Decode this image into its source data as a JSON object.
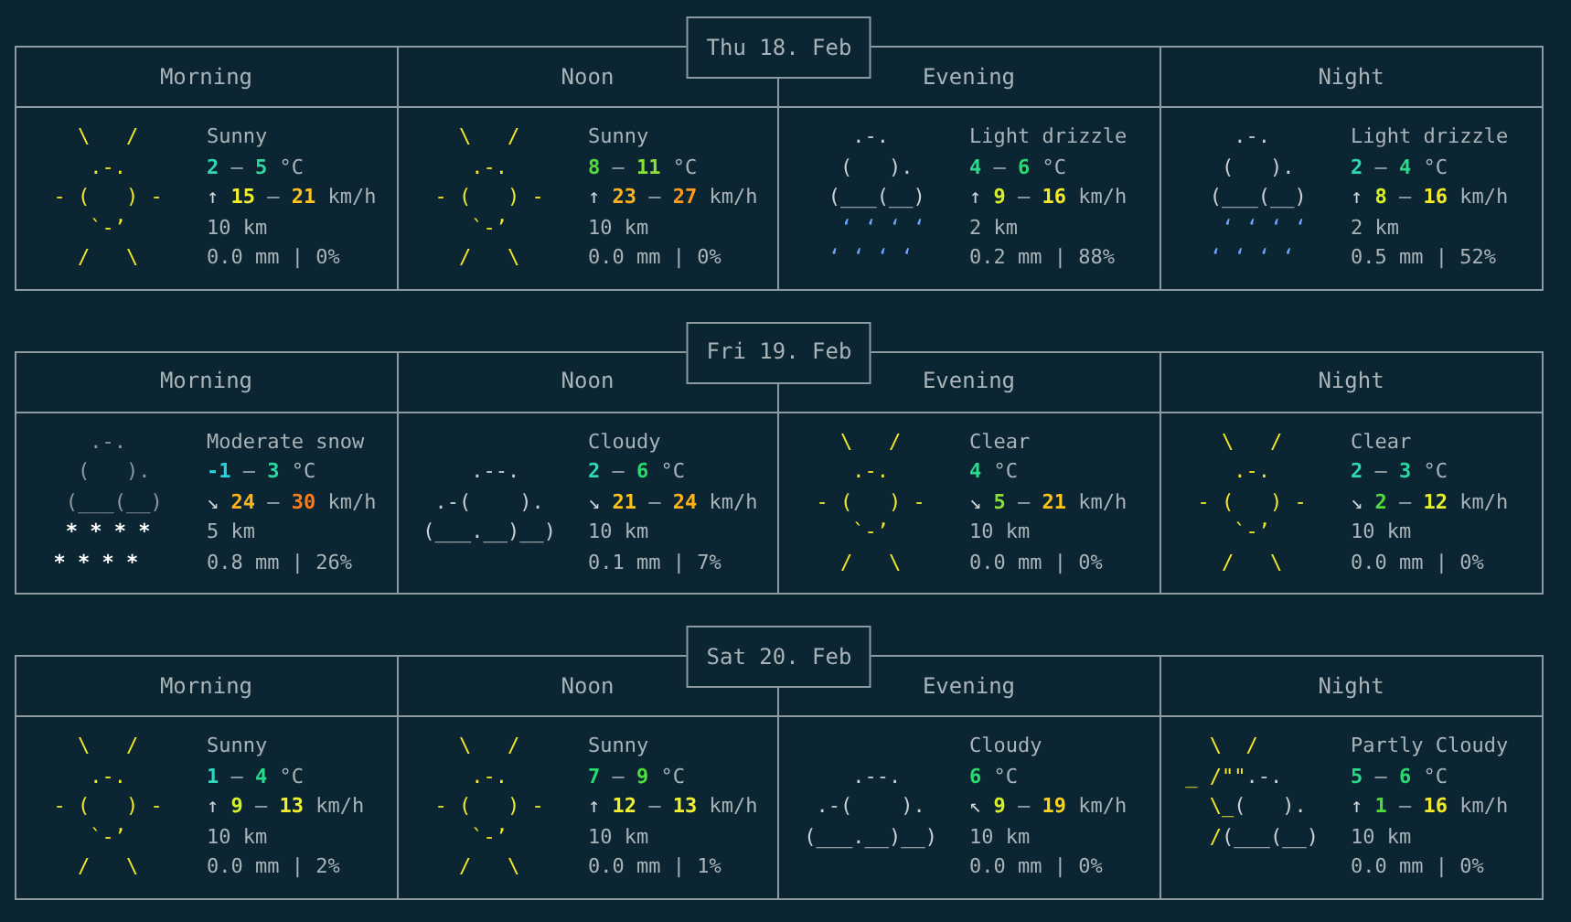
{
  "days": [
    {
      "date": "Thu 18. Feb",
      "periods": [
        {
          "label": "Morning",
          "condition": "Sunny",
          "art": {
            "kind": "sunny",
            "lines": [
              [
                {
                  "kind": "sun",
                  "text": "    \\   /"
                }
              ],
              [
                {
                  "kind": "sun",
                  "text": "     .-."
                }
              ],
              [
                {
                  "kind": "sun",
                  "text": "  - (   ) -"
                }
              ],
              [
                {
                  "kind": "sun",
                  "text": "     `-’"
                }
              ],
              [
                {
                  "kind": "sun",
                  "text": "    /   \\"
                }
              ]
            ]
          },
          "temperature": {
            "values": [
              {
                "text": "2",
                "color": "#2ed9b0"
              },
              {
                "text": "5",
                "color": "#2ed9a0"
              }
            ],
            "separator": "–",
            "unit": "°C"
          },
          "wind": {
            "arrow": "↑",
            "values": [
              {
                "text": "15",
                "color": "#f2f02a"
              },
              {
                "text": "21",
                "color": "#ffc21a"
              }
            ],
            "separator": "–",
            "unit": "km/h"
          },
          "visibility": "10 km",
          "precipitation": "0.0 mm | 0%"
        },
        {
          "label": "Noon",
          "condition": "Sunny",
          "art": {
            "kind": "sunny",
            "lines": [
              [
                {
                  "kind": "sun",
                  "text": "    \\   /"
                }
              ],
              [
                {
                  "kind": "sun",
                  "text": "     .-."
                }
              ],
              [
                {
                  "kind": "sun",
                  "text": "  - (   ) -"
                }
              ],
              [
                {
                  "kind": "sun",
                  "text": "     `-’"
                }
              ],
              [
                {
                  "kind": "sun",
                  "text": "    /   \\"
                }
              ]
            ]
          },
          "temperature": {
            "values": [
              {
                "text": "8",
                "color": "#4fdc3c"
              },
              {
                "text": "11",
                "color": "#8be236"
              }
            ],
            "separator": "–",
            "unit": "°C"
          },
          "wind": {
            "arrow": "↑",
            "values": [
              {
                "text": "23",
                "color": "#ffb31a"
              },
              {
                "text": "27",
                "color": "#ff9a1a"
              }
            ],
            "separator": "–",
            "unit": "km/h"
          },
          "visibility": "10 km",
          "precipitation": "0.0 mm | 0%"
        },
        {
          "label": "Evening",
          "condition": "Light drizzle",
          "art": {
            "kind": "drizzle",
            "lines": [
              [
                {
                  "kind": "cloud",
                  "text": "     .-."
                }
              ],
              [
                {
                  "kind": "cloud",
                  "text": "    (   )."
                }
              ],
              [
                {
                  "kind": "cloud",
                  "text": "   (___(__)"
                }
              ],
              [
                {
                  "kind": "rain",
                  "text": "    ‘ ‘ ‘ ‘"
                }
              ],
              [
                {
                  "kind": "rain",
                  "text": "   ‘ ‘ ‘ ‘"
                }
              ]
            ]
          },
          "temperature": {
            "values": [
              {
                "text": "4",
                "color": "#2ad98a"
              },
              {
                "text": "6",
                "color": "#2ad970"
              }
            ],
            "separator": "–",
            "unit": "°C"
          },
          "wind": {
            "arrow": "↑",
            "values": [
              {
                "text": "9",
                "color": "#d8ef2a"
              },
              {
                "text": "16",
                "color": "#f5e82a"
              }
            ],
            "separator": "–",
            "unit": "km/h"
          },
          "visibility": "2 km",
          "precipitation": "0.2 mm | 88%"
        },
        {
          "label": "Night",
          "condition": "Light drizzle",
          "art": {
            "kind": "drizzle",
            "lines": [
              [
                {
                  "kind": "cloud",
                  "text": "     .-."
                }
              ],
              [
                {
                  "kind": "cloud",
                  "text": "    (   )."
                }
              ],
              [
                {
                  "kind": "cloud",
                  "text": "   (___(__)"
                }
              ],
              [
                {
                  "kind": "rain",
                  "text": "    ‘ ‘ ‘ ‘"
                }
              ],
              [
                {
                  "kind": "rain",
                  "text": "   ‘ ‘ ‘ ‘"
                }
              ]
            ]
          },
          "temperature": {
            "values": [
              {
                "text": "2",
                "color": "#2ed9b0"
              },
              {
                "text": "4",
                "color": "#2ad98a"
              }
            ],
            "separator": "–",
            "unit": "°C"
          },
          "wind": {
            "arrow": "↑",
            "values": [
              {
                "text": "8",
                "color": "#d8ef2a"
              },
              {
                "text": "16",
                "color": "#f5e82a"
              }
            ],
            "separator": "–",
            "unit": "km/h"
          },
          "visibility": "2 km",
          "precipitation": "0.5 mm | 52%"
        }
      ]
    },
    {
      "date": "Fri 19. Feb",
      "periods": [
        {
          "label": "Morning",
          "condition": "Moderate snow",
          "art": {
            "kind": "snow",
            "lines": [
              [
                {
                  "kind": "dark_cloud",
                  "text": "     .-."
                }
              ],
              [
                {
                  "kind": "dark_cloud",
                  "text": "    (   )."
                }
              ],
              [
                {
                  "kind": "dark_cloud",
                  "text": "   (___(__)"
                }
              ],
              [
                {
                  "kind": "snow",
                  "text": "   * * * *"
                }
              ],
              [
                {
                  "kind": "snow",
                  "text": "  * * * *"
                }
              ]
            ]
          },
          "temperature": {
            "values": [
              {
                "text": "-1",
                "color": "#27d3e0"
              },
              {
                "text": "3",
                "color": "#2ed9a0"
              }
            ],
            "separator": "–",
            "unit": "°C"
          },
          "wind": {
            "arrow": "↘",
            "values": [
              {
                "text": "24",
                "color": "#ffb31a"
              },
              {
                "text": "30",
                "color": "#ff7a1a"
              }
            ],
            "separator": "–",
            "unit": "km/h"
          },
          "visibility": "5 km",
          "precipitation": "0.8 mm | 26%"
        },
        {
          "label": "Noon",
          "condition": "Cloudy",
          "art": {
            "kind": "cloudy",
            "lines": [
              [
                {
                  "kind": "cloud",
                  "text": "     .--."
                }
              ],
              [
                {
                  "kind": "cloud",
                  "text": "  .-(    )."
                }
              ],
              [
                {
                  "kind": "cloud",
                  "text": " (___.__)__)"
                }
              ]
            ]
          },
          "temperature": {
            "values": [
              {
                "text": "2",
                "color": "#2ed9b0"
              },
              {
                "text": "6",
                "color": "#2ad970"
              }
            ],
            "separator": "–",
            "unit": "°C"
          },
          "wind": {
            "arrow": "↘",
            "values": [
              {
                "text": "21",
                "color": "#ffc21a"
              },
              {
                "text": "24",
                "color": "#ffb31a"
              }
            ],
            "separator": "–",
            "unit": "km/h"
          },
          "visibility": "10 km",
          "precipitation": "0.1 mm | 7%"
        },
        {
          "label": "Evening",
          "condition": "Clear",
          "art": {
            "kind": "sunny",
            "lines": [
              [
                {
                  "kind": "sun",
                  "text": "    \\   /"
                }
              ],
              [
                {
                  "kind": "sun",
                  "text": "     .-."
                }
              ],
              [
                {
                  "kind": "sun",
                  "text": "  - (   ) -"
                }
              ],
              [
                {
                  "kind": "sun",
                  "text": "     `-’"
                }
              ],
              [
                {
                  "kind": "sun",
                  "text": "    /   \\"
                }
              ]
            ]
          },
          "temperature": {
            "values": [
              {
                "text": "4",
                "color": "#2ad98a"
              }
            ],
            "unit": "°C"
          },
          "wind": {
            "arrow": "↘",
            "values": [
              {
                "text": "5",
                "color": "#8be236"
              },
              {
                "text": "21",
                "color": "#ffc21a"
              }
            ],
            "separator": "–",
            "unit": "km/h"
          },
          "visibility": "10 km",
          "precipitation": "0.0 mm | 0%"
        },
        {
          "label": "Night",
          "condition": "Clear",
          "art": {
            "kind": "sunny",
            "lines": [
              [
                {
                  "kind": "sun",
                  "text": "    \\   /"
                }
              ],
              [
                {
                  "kind": "sun",
                  "text": "     .-."
                }
              ],
              [
                {
                  "kind": "sun",
                  "text": "  - (   ) -"
                }
              ],
              [
                {
                  "kind": "sun",
                  "text": "     `-’"
                }
              ],
              [
                {
                  "kind": "sun",
                  "text": "    /   \\"
                }
              ]
            ]
          },
          "temperature": {
            "values": [
              {
                "text": "2",
                "color": "#2ed9b0"
              },
              {
                "text": "3",
                "color": "#2ed9a0"
              }
            ],
            "separator": "–",
            "unit": "°C"
          },
          "wind": {
            "arrow": "↘",
            "values": [
              {
                "text": "2",
                "color": "#4fdc3c"
              },
              {
                "text": "12",
                "color": "#e5f02a"
              }
            ],
            "separator": "–",
            "unit": "km/h"
          },
          "visibility": "10 km",
          "precipitation": "0.0 mm | 0%"
        }
      ]
    },
    {
      "date": "Sat 20. Feb",
      "periods": [
        {
          "label": "Morning",
          "condition": "Sunny",
          "art": {
            "kind": "sunny",
            "lines": [
              [
                {
                  "kind": "sun",
                  "text": "    \\   /"
                }
              ],
              [
                {
                  "kind": "sun",
                  "text": "     .-."
                }
              ],
              [
                {
                  "kind": "sun",
                  "text": "  - (   ) -"
                }
              ],
              [
                {
                  "kind": "sun",
                  "text": "     `-’"
                }
              ],
              [
                {
                  "kind": "sun",
                  "text": "    /   \\"
                }
              ]
            ]
          },
          "temperature": {
            "values": [
              {
                "text": "1",
                "color": "#2ed9c0"
              },
              {
                "text": "4",
                "color": "#2ad98a"
              }
            ],
            "separator": "–",
            "unit": "°C"
          },
          "wind": {
            "arrow": "↑",
            "values": [
              {
                "text": "9",
                "color": "#d8ef2a"
              },
              {
                "text": "13",
                "color": "#f2f02a"
              }
            ],
            "separator": "–",
            "unit": "km/h"
          },
          "visibility": "10 km",
          "precipitation": "0.0 mm | 2%"
        },
        {
          "label": "Noon",
          "condition": "Sunny",
          "art": {
            "kind": "sunny",
            "lines": [
              [
                {
                  "kind": "sun",
                  "text": "    \\   /"
                }
              ],
              [
                {
                  "kind": "sun",
                  "text": "     .-."
                }
              ],
              [
                {
                  "kind": "sun",
                  "text": "  - (   ) -"
                }
              ],
              [
                {
                  "kind": "sun",
                  "text": "     `-’"
                }
              ],
              [
                {
                  "kind": "sun",
                  "text": "    /   \\"
                }
              ]
            ]
          },
          "temperature": {
            "values": [
              {
                "text": "7",
                "color": "#2ad970"
              },
              {
                "text": "9",
                "color": "#4fdc3c"
              }
            ],
            "separator": "–",
            "unit": "°C"
          },
          "wind": {
            "arrow": "↑",
            "values": [
              {
                "text": "12",
                "color": "#f2f02a"
              },
              {
                "text": "13",
                "color": "#f2f02a"
              }
            ],
            "separator": "–",
            "unit": "km/h"
          },
          "visibility": "10 km",
          "precipitation": "0.0 mm | 1%"
        },
        {
          "label": "Evening",
          "condition": "Cloudy",
          "art": {
            "kind": "cloudy",
            "lines": [
              [
                {
                  "kind": "cloud",
                  "text": "     .--."
                }
              ],
              [
                {
                  "kind": "cloud",
                  "text": "  .-(    )."
                }
              ],
              [
                {
                  "kind": "cloud",
                  "text": " (___.__)__)"
                }
              ]
            ]
          },
          "temperature": {
            "values": [
              {
                "text": "6",
                "color": "#2ad970"
              }
            ],
            "unit": "°C"
          },
          "wind": {
            "arrow": "↖",
            "values": [
              {
                "text": "9",
                "color": "#d8ef2a"
              },
              {
                "text": "19",
                "color": "#ffd21a"
              }
            ],
            "separator": "–",
            "unit": "km/h"
          },
          "visibility": "10 km",
          "precipitation": "0.0 mm | 0%"
        },
        {
          "label": "Night",
          "condition": "Partly Cloudy",
          "art": {
            "kind": "partly_cloudy",
            "lines": [
              [
                {
                  "kind": "sun",
                  "text": "   \\  /"
                }
              ],
              [
                {
                  "kind": "sun",
                  "text": " _ /\"\""
                },
                {
                  "kind": "cloud",
                  "text": ".-."
                }
              ],
              [
                {
                  "kind": "sun",
                  "text": "   \\_"
                },
                {
                  "kind": "cloud",
                  "text": "(   )."
                }
              ],
              [
                {
                  "kind": "sun",
                  "text": "   /"
                },
                {
                  "kind": "cloud",
                  "text": "(___(__)"
                }
              ]
            ]
          },
          "temperature": {
            "values": [
              {
                "text": "5",
                "color": "#2ad98a"
              },
              {
                "text": "6",
                "color": "#2ad970"
              }
            ],
            "separator": "–",
            "unit": "°C"
          },
          "wind": {
            "arrow": "↑",
            "values": [
              {
                "text": "1",
                "color": "#4fdc3c"
              },
              {
                "text": "16",
                "color": "#f5e82a"
              }
            ],
            "separator": "–",
            "unit": "km/h"
          },
          "visibility": "10 km",
          "precipitation": "0.0 mm | 0%"
        }
      ]
    }
  ]
}
